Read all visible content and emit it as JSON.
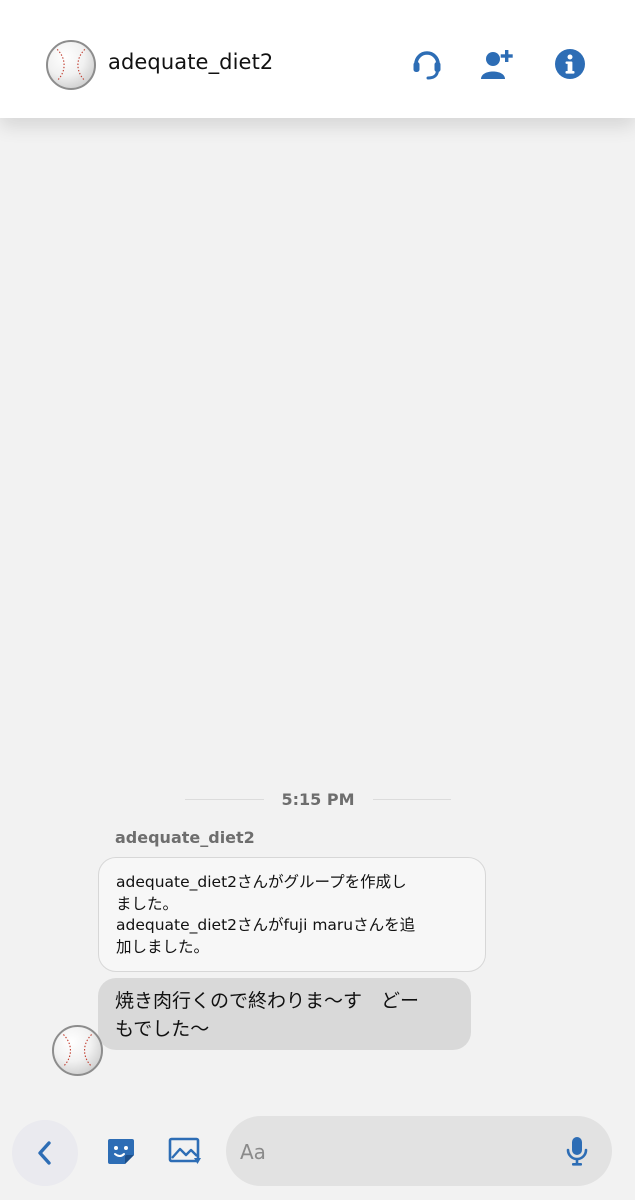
{
  "header": {
    "title": "adequate_diet2",
    "avatar_icon": "baseball-icon",
    "icons": [
      "headset-icon",
      "add-person-icon",
      "info-icon"
    ],
    "accent_color": "#2d6db5"
  },
  "conversation": {
    "timestamp": "5:15 PM",
    "sender": "adequate_diet2",
    "system_lines": [
      "adequate_diet2さんがグループを作成し",
      "ました。",
      "adequate_diet2さんがfuji maruさんを追",
      "加しました。"
    ],
    "message_lines": [
      "焼き肉行くので終わりま〜す　どー",
      "もでした〜"
    ]
  },
  "composer": {
    "placeholder": "Aa",
    "icons": [
      "back-chevron-icon",
      "sticker-icon",
      "image-icon",
      "microphone-icon"
    ]
  }
}
